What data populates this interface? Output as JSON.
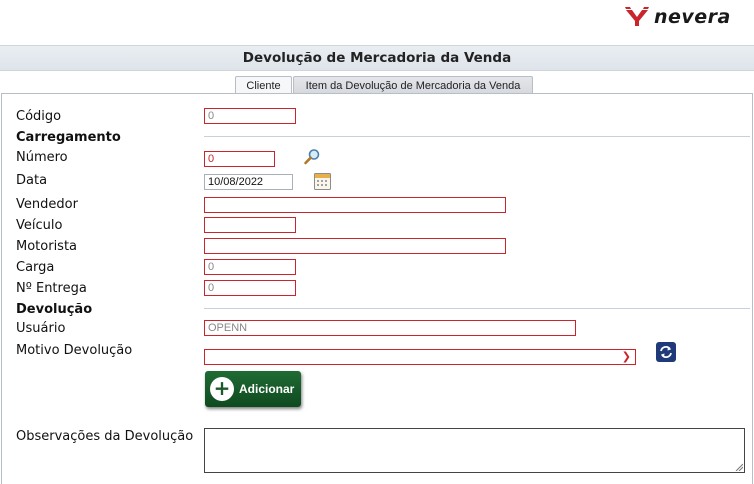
{
  "brand": {
    "name": "nevera",
    "color": "#c8262c"
  },
  "page": {
    "title": "Devolução de Mercadoria da Venda"
  },
  "tabs": [
    {
      "label": "Cliente"
    },
    {
      "label": "Item da Devolução de Mercadoria da Venda"
    }
  ],
  "form": {
    "codigo": {
      "label": "Código",
      "value": "0"
    },
    "carregamento_section": "Carregamento",
    "numero": {
      "label": "Número",
      "value": "0"
    },
    "data": {
      "label": "Data",
      "value": "10/08/2022"
    },
    "vendedor": {
      "label": "Vendedor",
      "value": ""
    },
    "veiculo": {
      "label": "Veículo",
      "value": ""
    },
    "motorista": {
      "label": "Motorista",
      "value": ""
    },
    "carga": {
      "label": "Carga",
      "value": "0"
    },
    "n_entrega": {
      "label": "Nº Entrega",
      "value": "0"
    },
    "devolucao_section": "Devolução",
    "usuario": {
      "label": "Usuário",
      "value": "OPENN"
    },
    "motivo": {
      "label": "Motivo Devolução",
      "value": ""
    },
    "add_button": "Adicionar",
    "observacoes": {
      "label": "Observações da Devolução",
      "value": ""
    }
  },
  "icons": {
    "search": "magnifier-icon",
    "calendar": "calendar-icon",
    "refresh": "refresh-icon",
    "add": "plus-circle-icon"
  }
}
